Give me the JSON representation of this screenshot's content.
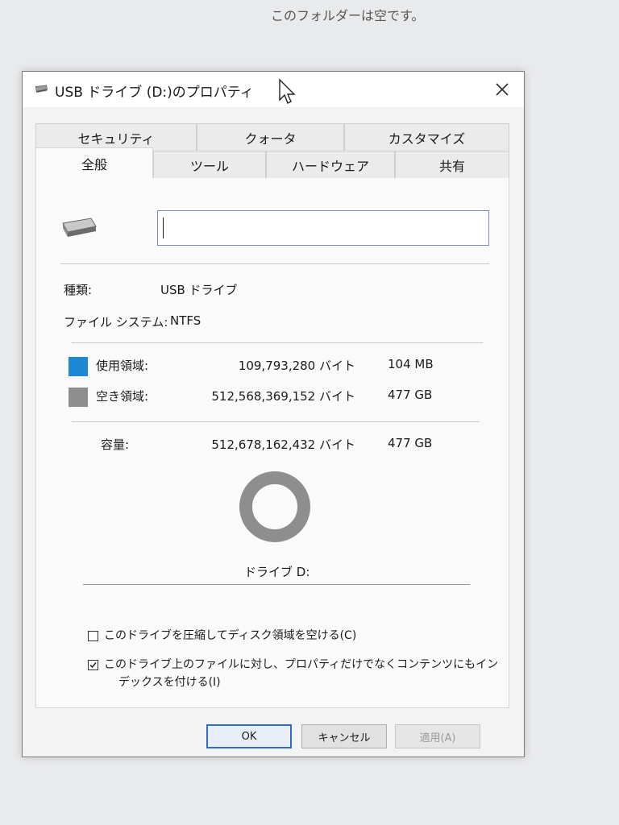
{
  "background": {
    "message": "このフォルダーは空です。"
  },
  "dialog": {
    "title": "USB ドライブ (D:)のプロパティ",
    "tabs_back": [
      "セキュリティ",
      "クォータ",
      "カスタマイズ"
    ],
    "tabs_front": [
      "全般",
      "ツール",
      "ハードウェア",
      "共有"
    ],
    "active_tab": "全般",
    "name_field": {
      "value": ""
    },
    "type_label": "種類:",
    "type_value": "USB ドライブ",
    "fs_label": "ファイル システム:",
    "fs_value": "NTFS",
    "used": {
      "label": "使用領域:",
      "bytes": "109,793,280 バイト",
      "size": "104 MB",
      "color": "#1e88d4"
    },
    "free": {
      "label": "空き領域:",
      "bytes": "512,568,369,152 バイト",
      "size": "477 GB",
      "color": "#8e8e8e"
    },
    "capacity": {
      "label": "容量:",
      "bytes": "512,678,162,432 バイト",
      "size": "477 GB"
    },
    "drive_label": "ドライブ D:",
    "compress_checkbox": {
      "label": "このドライブを圧縮してディスク領域を空ける(C)",
      "checked": false
    },
    "index_checkbox": {
      "label_line1": "このドライブ上のファイルに対し、プロパティだけでなくコンテンツにもイン",
      "label_line2": "デックスを付ける(I)",
      "checked": true
    },
    "buttons": {
      "ok": "OK",
      "cancel": "キャンセル",
      "apply": "適用(A)"
    }
  },
  "chart_data": {
    "type": "pie",
    "categories": [
      "使用領域",
      "空き領域"
    ],
    "values": [
      109793280,
      512568369152
    ],
    "colors": [
      "#1e88d4",
      "#8e8e8e"
    ]
  }
}
